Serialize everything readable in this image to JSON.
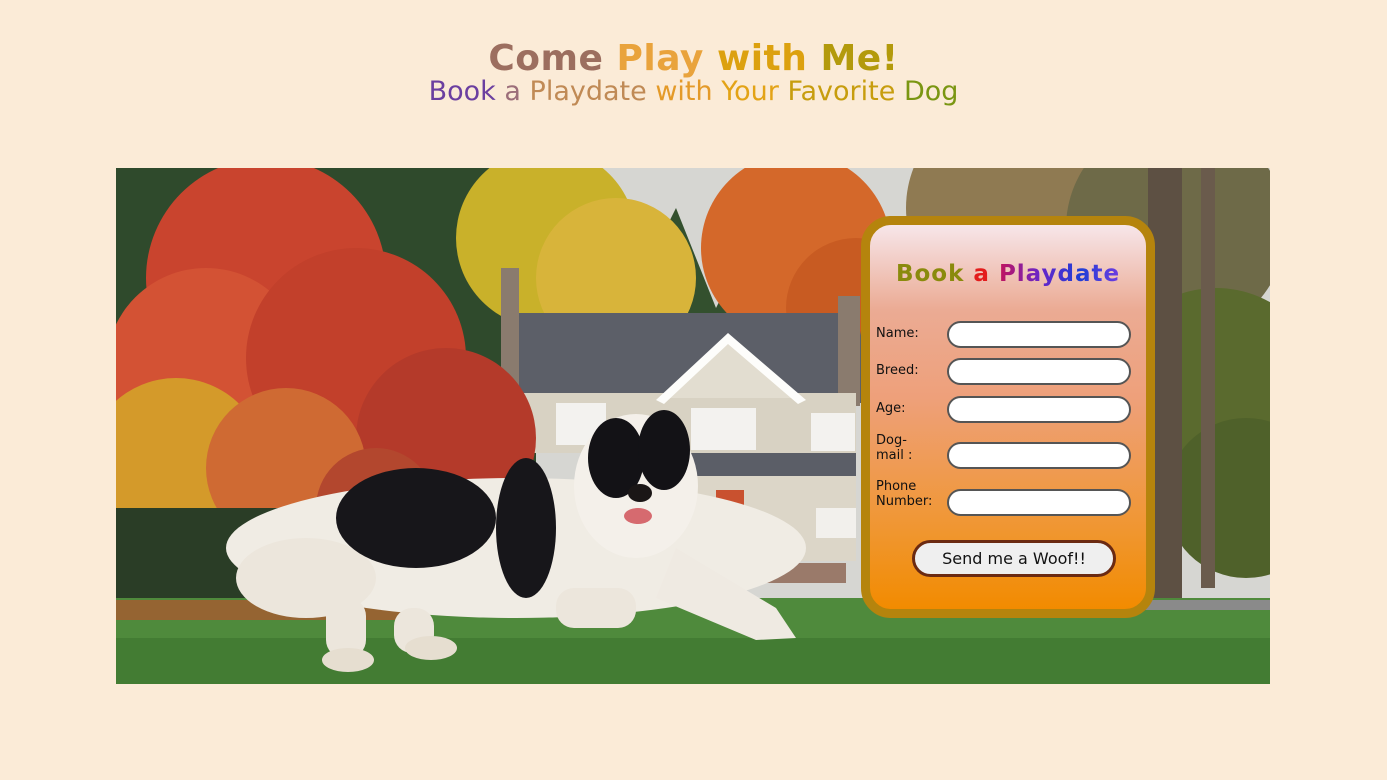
{
  "header": {
    "title_words": [
      "Come",
      "Play",
      "with",
      "Me!"
    ],
    "subtitle_words": [
      "Book",
      "a",
      "Playdate",
      "with",
      "Your",
      "Favorite",
      "Dog"
    ]
  },
  "form": {
    "title_words": [
      "Book",
      "a",
      "Playdate"
    ],
    "fields": [
      {
        "label": "Name:",
        "value": ""
      },
      {
        "label": "Breed:",
        "value": ""
      },
      {
        "label": "Age:",
        "value": ""
      },
      {
        "label": "Dog-mail :",
        "value": ""
      },
      {
        "label": "Phone Number:",
        "value": ""
      }
    ],
    "submit_label": "Send me a Woof!!"
  },
  "colors": {
    "page_background": "#fbebd7",
    "form_border": "#b5840d",
    "form_gradient_bottom": "#f28b00",
    "button_border": "#6b2a12"
  }
}
